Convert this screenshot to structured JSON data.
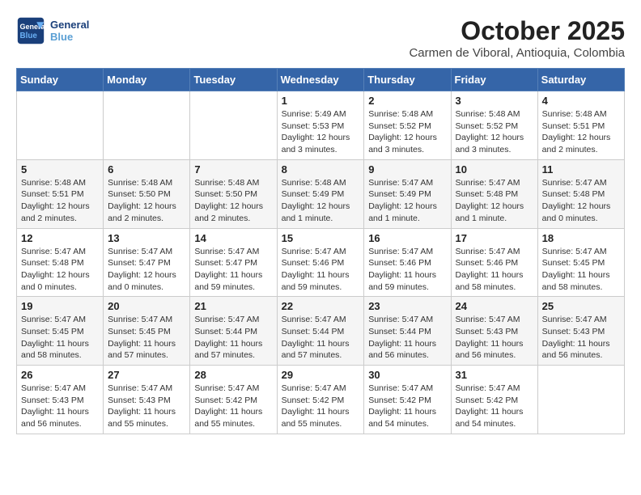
{
  "header": {
    "logo_line1": "General",
    "logo_line2": "Blue",
    "month": "October 2025",
    "location": "Carmen de Viboral, Antioquia, Colombia"
  },
  "weekdays": [
    "Sunday",
    "Monday",
    "Tuesday",
    "Wednesday",
    "Thursday",
    "Friday",
    "Saturday"
  ],
  "weeks": [
    [
      {
        "day": "",
        "info": ""
      },
      {
        "day": "",
        "info": ""
      },
      {
        "day": "",
        "info": ""
      },
      {
        "day": "1",
        "info": "Sunrise: 5:49 AM\nSunset: 5:53 PM\nDaylight: 12 hours and 3 minutes."
      },
      {
        "day": "2",
        "info": "Sunrise: 5:48 AM\nSunset: 5:52 PM\nDaylight: 12 hours and 3 minutes."
      },
      {
        "day": "3",
        "info": "Sunrise: 5:48 AM\nSunset: 5:52 PM\nDaylight: 12 hours and 3 minutes."
      },
      {
        "day": "4",
        "info": "Sunrise: 5:48 AM\nSunset: 5:51 PM\nDaylight: 12 hours and 2 minutes."
      }
    ],
    [
      {
        "day": "5",
        "info": "Sunrise: 5:48 AM\nSunset: 5:51 PM\nDaylight: 12 hours and 2 minutes."
      },
      {
        "day": "6",
        "info": "Sunrise: 5:48 AM\nSunset: 5:50 PM\nDaylight: 12 hours and 2 minutes."
      },
      {
        "day": "7",
        "info": "Sunrise: 5:48 AM\nSunset: 5:50 PM\nDaylight: 12 hours and 2 minutes."
      },
      {
        "day": "8",
        "info": "Sunrise: 5:48 AM\nSunset: 5:49 PM\nDaylight: 12 hours and 1 minute."
      },
      {
        "day": "9",
        "info": "Sunrise: 5:47 AM\nSunset: 5:49 PM\nDaylight: 12 hours and 1 minute."
      },
      {
        "day": "10",
        "info": "Sunrise: 5:47 AM\nSunset: 5:48 PM\nDaylight: 12 hours and 1 minute."
      },
      {
        "day": "11",
        "info": "Sunrise: 5:47 AM\nSunset: 5:48 PM\nDaylight: 12 hours and 0 minutes."
      }
    ],
    [
      {
        "day": "12",
        "info": "Sunrise: 5:47 AM\nSunset: 5:48 PM\nDaylight: 12 hours and 0 minutes."
      },
      {
        "day": "13",
        "info": "Sunrise: 5:47 AM\nSunset: 5:47 PM\nDaylight: 12 hours and 0 minutes."
      },
      {
        "day": "14",
        "info": "Sunrise: 5:47 AM\nSunset: 5:47 PM\nDaylight: 11 hours and 59 minutes."
      },
      {
        "day": "15",
        "info": "Sunrise: 5:47 AM\nSunset: 5:46 PM\nDaylight: 11 hours and 59 minutes."
      },
      {
        "day": "16",
        "info": "Sunrise: 5:47 AM\nSunset: 5:46 PM\nDaylight: 11 hours and 59 minutes."
      },
      {
        "day": "17",
        "info": "Sunrise: 5:47 AM\nSunset: 5:46 PM\nDaylight: 11 hours and 58 minutes."
      },
      {
        "day": "18",
        "info": "Sunrise: 5:47 AM\nSunset: 5:45 PM\nDaylight: 11 hours and 58 minutes."
      }
    ],
    [
      {
        "day": "19",
        "info": "Sunrise: 5:47 AM\nSunset: 5:45 PM\nDaylight: 11 hours and 58 minutes."
      },
      {
        "day": "20",
        "info": "Sunrise: 5:47 AM\nSunset: 5:45 PM\nDaylight: 11 hours and 57 minutes."
      },
      {
        "day": "21",
        "info": "Sunrise: 5:47 AM\nSunset: 5:44 PM\nDaylight: 11 hours and 57 minutes."
      },
      {
        "day": "22",
        "info": "Sunrise: 5:47 AM\nSunset: 5:44 PM\nDaylight: 11 hours and 57 minutes."
      },
      {
        "day": "23",
        "info": "Sunrise: 5:47 AM\nSunset: 5:44 PM\nDaylight: 11 hours and 56 minutes."
      },
      {
        "day": "24",
        "info": "Sunrise: 5:47 AM\nSunset: 5:43 PM\nDaylight: 11 hours and 56 minutes."
      },
      {
        "day": "25",
        "info": "Sunrise: 5:47 AM\nSunset: 5:43 PM\nDaylight: 11 hours and 56 minutes."
      }
    ],
    [
      {
        "day": "26",
        "info": "Sunrise: 5:47 AM\nSunset: 5:43 PM\nDaylight: 11 hours and 56 minutes."
      },
      {
        "day": "27",
        "info": "Sunrise: 5:47 AM\nSunset: 5:43 PM\nDaylight: 11 hours and 55 minutes."
      },
      {
        "day": "28",
        "info": "Sunrise: 5:47 AM\nSunset: 5:42 PM\nDaylight: 11 hours and 55 minutes."
      },
      {
        "day": "29",
        "info": "Sunrise: 5:47 AM\nSunset: 5:42 PM\nDaylight: 11 hours and 55 minutes."
      },
      {
        "day": "30",
        "info": "Sunrise: 5:47 AM\nSunset: 5:42 PM\nDaylight: 11 hours and 54 minutes."
      },
      {
        "day": "31",
        "info": "Sunrise: 5:47 AM\nSunset: 5:42 PM\nDaylight: 11 hours and 54 minutes."
      },
      {
        "day": "",
        "info": ""
      }
    ]
  ]
}
